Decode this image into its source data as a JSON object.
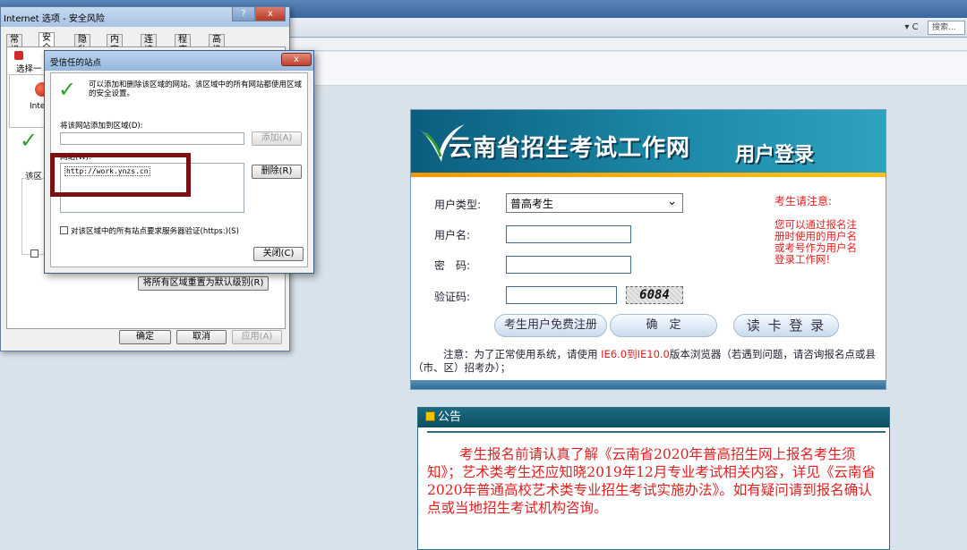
{
  "browser": {
    "refresh_label": "▾ C",
    "search_placeholder": "搜索..."
  },
  "login": {
    "site_title": "云南省招生考试工作网",
    "title": "用户登录",
    "user_type_label": "用户类型:",
    "user_type_value": "普高考生",
    "username_label": "用户名:",
    "password_label": "密　码:",
    "captcha_label": "验证码:",
    "captcha_value": "6084",
    "register_button": "考生用户免费注册",
    "confirm_button": "确　定",
    "card_login_button": "读 卡 登 录",
    "notice_title": "考生请注意:",
    "notice_body": "您可以通过报名注册时使用的用户名或考号作为用户名登录工作网!",
    "note_prefix": "注意：为了正常使用系统，请使用 ",
    "note_version": "IE6.0到IE10.0",
    "note_suffix": "版本浏览器（若遇到问题，请咨询报名点或县（市、区）招考办）；"
  },
  "announcement": {
    "title": "公告",
    "body": "考生报名前请认真了解《云南省2020年普高招生网上报名考生须知》；艺术类考生还应知晓2019年12月专业考试相关内容，详见《云南省2020年普通高校艺术类专业招生考试实施办法》。如有疑问请到报名确认点或当地招生考试机构咨询。"
  },
  "inet_dialog": {
    "title": "Internet 选项 - 安全风险",
    "help_button": "?",
    "close_button": "x",
    "tabs": [
      "常规",
      "安全",
      "隐私",
      "内容",
      "连接",
      "程序",
      "高级"
    ],
    "select_zone_label": "选择一",
    "zone_short": "Inte",
    "zone_level_label": "该区",
    "reset_all_button": "将所有区域重置为默认级别(R)",
    "ok_button": "确定",
    "cancel_button": "取消",
    "apply_button": "应用(A)"
  },
  "trusted_dialog": {
    "title": "受信任的站点",
    "close_button": "x",
    "description": "可以添加和删除该区域的网站。该区域中的所有网站都使用区域的安全设置。",
    "add_label": "将该网站添加到区域(D):",
    "add_button": "添加(A)",
    "sites_label": "网站(W):",
    "sites": [
      "http://work.ynzs.cn"
    ],
    "remove_button": "删除(R)",
    "https_label": "对该区域中的所有站点要求服务器验证(https:)(S)",
    "close_dialog_button": "关闭(C)"
  }
}
